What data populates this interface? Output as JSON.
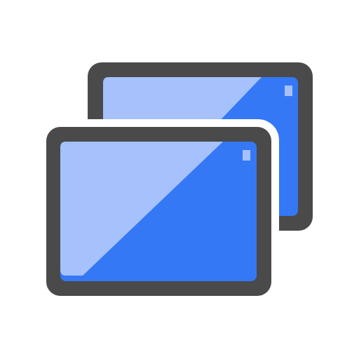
{
  "icon": {
    "name": "multiple-screens-icon",
    "colors": {
      "background": "#ffffff",
      "frame": "#4a4a4a",
      "screen_blue": "#3478f6",
      "screen_highlight": "#a6c1fb",
      "separator": "#ffffff"
    }
  }
}
